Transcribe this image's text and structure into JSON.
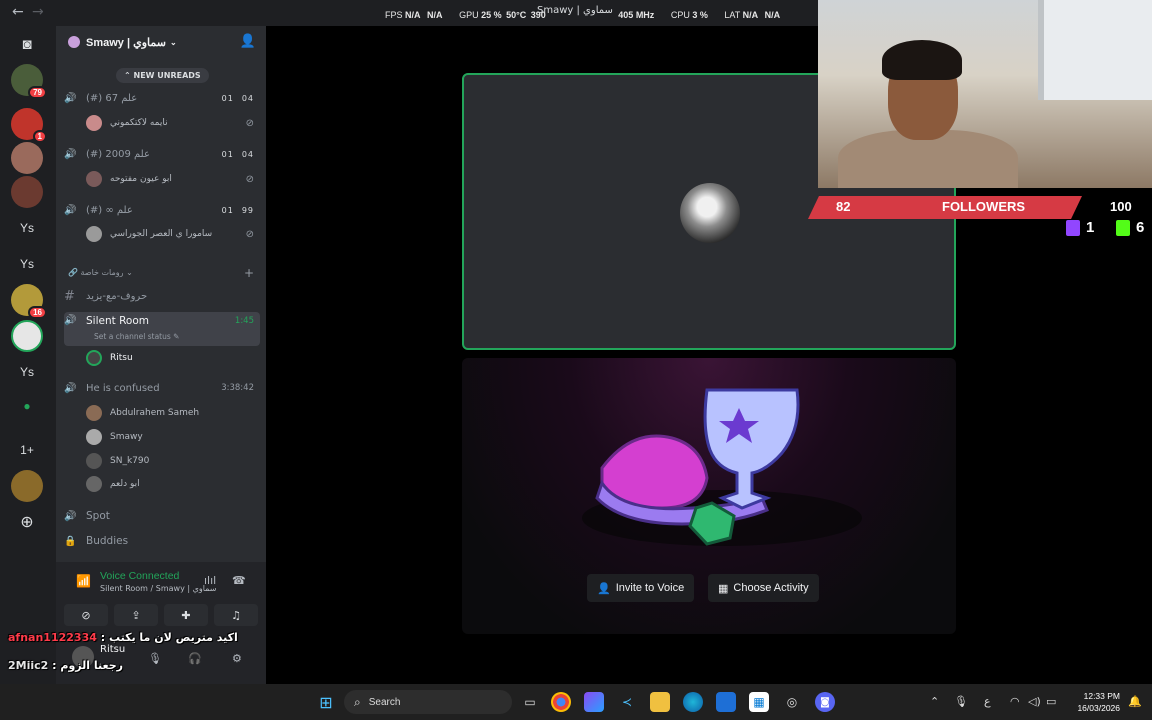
{
  "overlay_stats": {
    "fps_label": "FPS",
    "fps_a": "N/A",
    "fps_b": "N/A",
    "gpu_label": "GPU",
    "gpu_load": "25 %",
    "gpu_temp": "50°C",
    "gpu_clock": "390",
    "gpu_mem_clock": "405 MHz",
    "cpu_label": "CPU",
    "cpu_load": "3 %",
    "lat_label": "LAT",
    "lat_a": "N/A",
    "lat_b": "N/A"
  },
  "window_title": "Smawy | سماوي",
  "server": {
    "name": "Smawy | سماوي",
    "new_unreads": "NEW UNREADS"
  },
  "rail": {
    "badges": [
      "79",
      "1",
      "16"
    ],
    "labels": [
      "Ys",
      "Ys",
      "Ys",
      "1+"
    ]
  },
  "channels": [
    {
      "name": "(#) 67 علم",
      "count_a": "01",
      "count_b": "04",
      "user": "نايمه لاكتكموني"
    },
    {
      "name": "(#) 2009 علم",
      "count_a": "01",
      "count_b": "04",
      "user": "ابو عيون مفتوحه"
    },
    {
      "name": "(#) ∞ علم",
      "count_a": "01",
      "count_b": "99",
      "user": "سامورا ي العصر الجوراسي"
    }
  ],
  "category": "رومات خاصة",
  "text_channel": "حروف-مع-يزيد",
  "silent_room": {
    "name": "Silent Room",
    "time": "1:45",
    "status": "Set a channel status",
    "member": "Ritsu"
  },
  "confused_room": {
    "name": "He is confused",
    "time": "3:38:42",
    "members": [
      "Abdulrahem Sameh",
      "Smawy",
      "SN_k790",
      "ابو دلعم"
    ]
  },
  "other_channels": [
    "Spot",
    "Buddies"
  ],
  "voice_panel": {
    "title": "Voice Connected",
    "subtitle": "Silent Room / Smawy | سماوي",
    "username": "Ritsu"
  },
  "chat_overlay": [
    {
      "name": "afnan1122334",
      "message": "اكيد متريص لان ما يكتب"
    },
    {
      "name": "2Miic2",
      "message": "رجعنا الزوم"
    }
  ],
  "activity": {
    "invite_label": "Invite to Voice",
    "choose_label": "Choose Activity"
  },
  "stream_overlay": {
    "followers_count": "82",
    "followers_label": "FOLLOWERS",
    "followers_goal": "100",
    "twitch_count": "1",
    "kick_count": "6"
  },
  "taskbar": {
    "search_placeholder": "Search",
    "time": "12:33 PM",
    "date": "16/03/2026",
    "lang": "ع"
  },
  "colors": {
    "discord_green": "#23a55a",
    "follow_red": "#d63a44",
    "twitch_purple": "#9146ff",
    "kick_green": "#53fc18"
  }
}
